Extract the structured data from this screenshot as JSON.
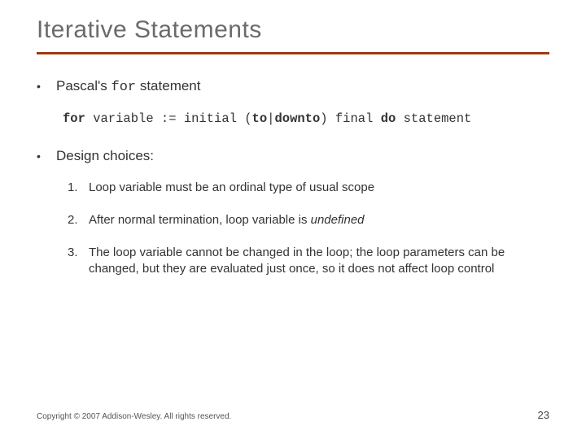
{
  "title": "Iterative Statements",
  "bullets": [
    {
      "prefix": "Pascal's ",
      "code": "for",
      "suffix": " statement"
    },
    {
      "text": "Design choices:"
    }
  ],
  "code": {
    "p1": "for",
    "p2": " variable := initial (",
    "p3": "to",
    "p4": "|",
    "p5": "downto",
    "p6": ") final ",
    "p7": "do",
    "p8": " statement"
  },
  "numbered": [
    {
      "n": "1.",
      "text": "Loop variable must be an ordinal type of usual scope"
    },
    {
      "n": "2.",
      "pre": "After normal termination, loop variable is ",
      "ital": "undefined"
    },
    {
      "n": "3.",
      "text": "The loop variable cannot be changed in the loop; the loop parameters can be changed, but they are evaluated just once, so it does not affect loop control"
    }
  ],
  "footer": {
    "copyright": "Copyright © 2007 Addison-Wesley. All rights reserved.",
    "page": "23"
  }
}
